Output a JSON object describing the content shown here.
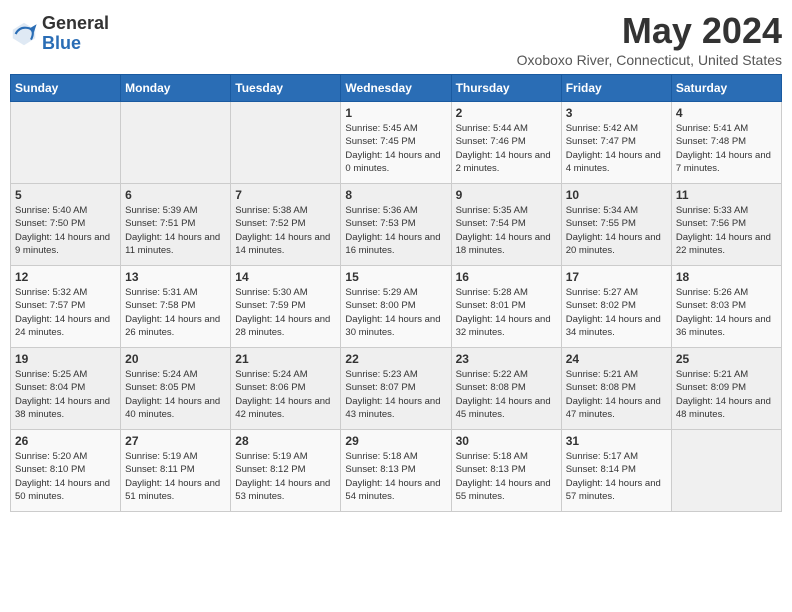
{
  "logo": {
    "general": "General",
    "blue": "Blue"
  },
  "header": {
    "month": "May 2024",
    "location": "Oxoboxo River, Connecticut, United States"
  },
  "weekdays": [
    "Sunday",
    "Monday",
    "Tuesday",
    "Wednesday",
    "Thursday",
    "Friday",
    "Saturday"
  ],
  "weeks": [
    [
      {
        "day": "",
        "empty": true
      },
      {
        "day": "",
        "empty": true
      },
      {
        "day": "",
        "empty": true
      },
      {
        "day": "1",
        "sunrise": "5:45 AM",
        "sunset": "7:45 PM",
        "daylight": "14 hours and 0 minutes."
      },
      {
        "day": "2",
        "sunrise": "5:44 AM",
        "sunset": "7:46 PM",
        "daylight": "14 hours and 2 minutes."
      },
      {
        "day": "3",
        "sunrise": "5:42 AM",
        "sunset": "7:47 PM",
        "daylight": "14 hours and 4 minutes."
      },
      {
        "day": "4",
        "sunrise": "5:41 AM",
        "sunset": "7:48 PM",
        "daylight": "14 hours and 7 minutes."
      }
    ],
    [
      {
        "day": "5",
        "sunrise": "5:40 AM",
        "sunset": "7:50 PM",
        "daylight": "14 hours and 9 minutes."
      },
      {
        "day": "6",
        "sunrise": "5:39 AM",
        "sunset": "7:51 PM",
        "daylight": "14 hours and 11 minutes."
      },
      {
        "day": "7",
        "sunrise": "5:38 AM",
        "sunset": "7:52 PM",
        "daylight": "14 hours and 14 minutes."
      },
      {
        "day": "8",
        "sunrise": "5:36 AM",
        "sunset": "7:53 PM",
        "daylight": "14 hours and 16 minutes."
      },
      {
        "day": "9",
        "sunrise": "5:35 AM",
        "sunset": "7:54 PM",
        "daylight": "14 hours and 18 minutes."
      },
      {
        "day": "10",
        "sunrise": "5:34 AM",
        "sunset": "7:55 PM",
        "daylight": "14 hours and 20 minutes."
      },
      {
        "day": "11",
        "sunrise": "5:33 AM",
        "sunset": "7:56 PM",
        "daylight": "14 hours and 22 minutes."
      }
    ],
    [
      {
        "day": "12",
        "sunrise": "5:32 AM",
        "sunset": "7:57 PM",
        "daylight": "14 hours and 24 minutes."
      },
      {
        "day": "13",
        "sunrise": "5:31 AM",
        "sunset": "7:58 PM",
        "daylight": "14 hours and 26 minutes."
      },
      {
        "day": "14",
        "sunrise": "5:30 AM",
        "sunset": "7:59 PM",
        "daylight": "14 hours and 28 minutes."
      },
      {
        "day": "15",
        "sunrise": "5:29 AM",
        "sunset": "8:00 PM",
        "daylight": "14 hours and 30 minutes."
      },
      {
        "day": "16",
        "sunrise": "5:28 AM",
        "sunset": "8:01 PM",
        "daylight": "14 hours and 32 minutes."
      },
      {
        "day": "17",
        "sunrise": "5:27 AM",
        "sunset": "8:02 PM",
        "daylight": "14 hours and 34 minutes."
      },
      {
        "day": "18",
        "sunrise": "5:26 AM",
        "sunset": "8:03 PM",
        "daylight": "14 hours and 36 minutes."
      }
    ],
    [
      {
        "day": "19",
        "sunrise": "5:25 AM",
        "sunset": "8:04 PM",
        "daylight": "14 hours and 38 minutes."
      },
      {
        "day": "20",
        "sunrise": "5:24 AM",
        "sunset": "8:05 PM",
        "daylight": "14 hours and 40 minutes."
      },
      {
        "day": "21",
        "sunrise": "5:24 AM",
        "sunset": "8:06 PM",
        "daylight": "14 hours and 42 minutes."
      },
      {
        "day": "22",
        "sunrise": "5:23 AM",
        "sunset": "8:07 PM",
        "daylight": "14 hours and 43 minutes."
      },
      {
        "day": "23",
        "sunrise": "5:22 AM",
        "sunset": "8:08 PM",
        "daylight": "14 hours and 45 minutes."
      },
      {
        "day": "24",
        "sunrise": "5:21 AM",
        "sunset": "8:08 PM",
        "daylight": "14 hours and 47 minutes."
      },
      {
        "day": "25",
        "sunrise": "5:21 AM",
        "sunset": "8:09 PM",
        "daylight": "14 hours and 48 minutes."
      }
    ],
    [
      {
        "day": "26",
        "sunrise": "5:20 AM",
        "sunset": "8:10 PM",
        "daylight": "14 hours and 50 minutes."
      },
      {
        "day": "27",
        "sunrise": "5:19 AM",
        "sunset": "8:11 PM",
        "daylight": "14 hours and 51 minutes."
      },
      {
        "day": "28",
        "sunrise": "5:19 AM",
        "sunset": "8:12 PM",
        "daylight": "14 hours and 53 minutes."
      },
      {
        "day": "29",
        "sunrise": "5:18 AM",
        "sunset": "8:13 PM",
        "daylight": "14 hours and 54 minutes."
      },
      {
        "day": "30",
        "sunrise": "5:18 AM",
        "sunset": "8:13 PM",
        "daylight": "14 hours and 55 minutes."
      },
      {
        "day": "31",
        "sunrise": "5:17 AM",
        "sunset": "8:14 PM",
        "daylight": "14 hours and 57 minutes."
      },
      {
        "day": "",
        "empty": true
      }
    ]
  ]
}
